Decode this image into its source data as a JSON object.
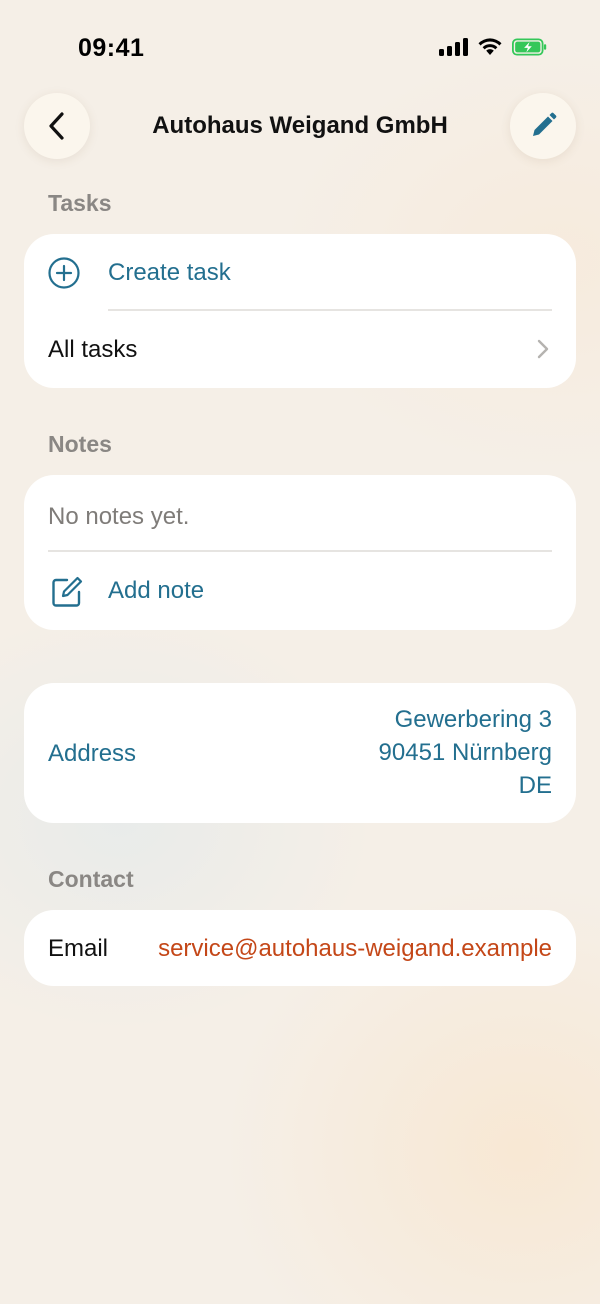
{
  "status_bar": {
    "time": "09:41",
    "icons": [
      "signal-icon",
      "wifi-icon",
      "battery-charging-icon"
    ],
    "battery_color": "#34c759"
  },
  "nav": {
    "title": "Autohaus Weigand GmbH",
    "back_icon": "chevron-left-icon",
    "edit_icon": "pencil-icon"
  },
  "tasks": {
    "header": "Tasks",
    "create_label": "Create task",
    "all_label": "All tasks"
  },
  "notes": {
    "header": "Notes",
    "empty_text": "No notes yet.",
    "add_label": "Add note"
  },
  "address": {
    "label": "Address",
    "lines": [
      "Gewerbering 3",
      "90451 Nürnberg",
      "DE"
    ]
  },
  "contact": {
    "header": "Contact",
    "email_label": "Email",
    "email_value": "service@autohaus-weigand.example"
  },
  "colors": {
    "accent": "#236f8f",
    "email": "#c44718",
    "section_header": "#8a8784"
  }
}
